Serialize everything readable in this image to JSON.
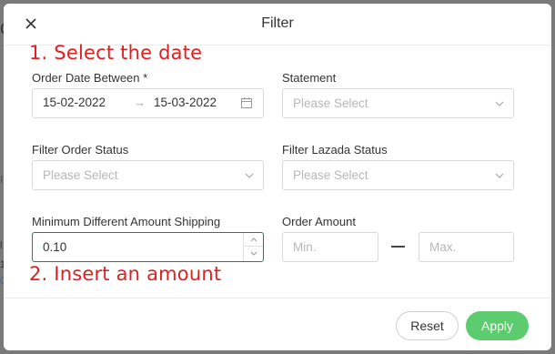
{
  "backdrop": {
    "frag_c": "C",
    "frag_f": "F",
    "frag_l": "l",
    "frag_1": "1",
    "frag_q": "Q"
  },
  "modal": {
    "title": "Filter",
    "close_icon": "close-icon"
  },
  "annotations": {
    "step1": "1. Select the date",
    "step2": "2. Insert an amount",
    "color": "#e02020"
  },
  "fields": {
    "order_date": {
      "label": "Order Date Between *",
      "start": "15-02-2022",
      "arrow": "→",
      "end": "15-03-2022",
      "icon": "calendar-icon"
    },
    "statement": {
      "label": "Statement",
      "placeholder": "Please Select"
    },
    "order_status": {
      "label": "Filter Order Status",
      "placeholder": "Please Select"
    },
    "lazada_status": {
      "label": "Filter Lazada Status",
      "placeholder": "Please Select"
    },
    "min_diff_amount": {
      "label": "Minimum Different Amount Shipping",
      "value": "0.10"
    },
    "order_amount": {
      "label": "Order Amount",
      "min_placeholder": "Min.",
      "max_placeholder": "Max."
    }
  },
  "footer": {
    "reset_label": "Reset",
    "apply_label": "Apply",
    "apply_color": "#5ccc6e",
    "focus_color": "#1b7a8c"
  }
}
